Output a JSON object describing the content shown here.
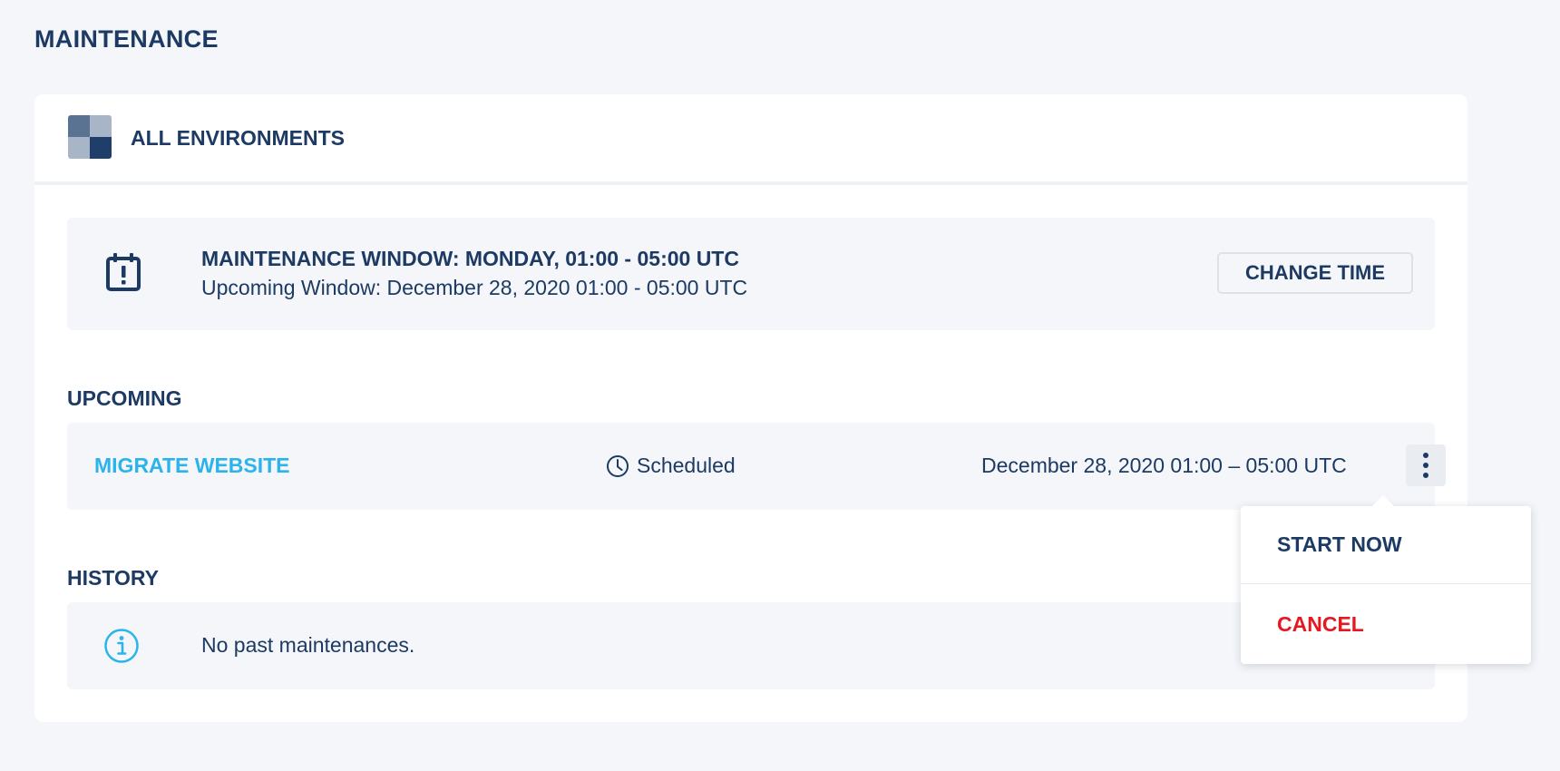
{
  "page": {
    "title": "MAINTENANCE"
  },
  "environment": {
    "title": "ALL ENVIRONMENTS",
    "icon": "environments-grid-icon"
  },
  "maintenance_window": {
    "icon": "calendar-alert-icon",
    "title": "MAINTENANCE WINDOW: MONDAY, 01:00 - 05:00 UTC",
    "subtitle": "Upcoming Window: December 28, 2020 01:00 - 05:00 UTC",
    "change_button_label": "CHANGE TIME"
  },
  "upcoming": {
    "label": "UPCOMING",
    "items": [
      {
        "name": "MIGRATE WEBSITE",
        "status_icon": "clock-icon",
        "status": "Scheduled",
        "time": "December 28, 2020 01:00 – 05:00 UTC"
      }
    ]
  },
  "history": {
    "label": "HISTORY",
    "icon": "info-icon",
    "empty_text": "No past maintenances."
  },
  "dropdown": {
    "items": [
      {
        "label": "START NOW"
      },
      {
        "label": "CANCEL"
      }
    ]
  },
  "colors": {
    "primary_text": "#1c3a63",
    "link": "#2bb3ec",
    "danger": "#e8171f",
    "background": "#f4f6f9"
  }
}
